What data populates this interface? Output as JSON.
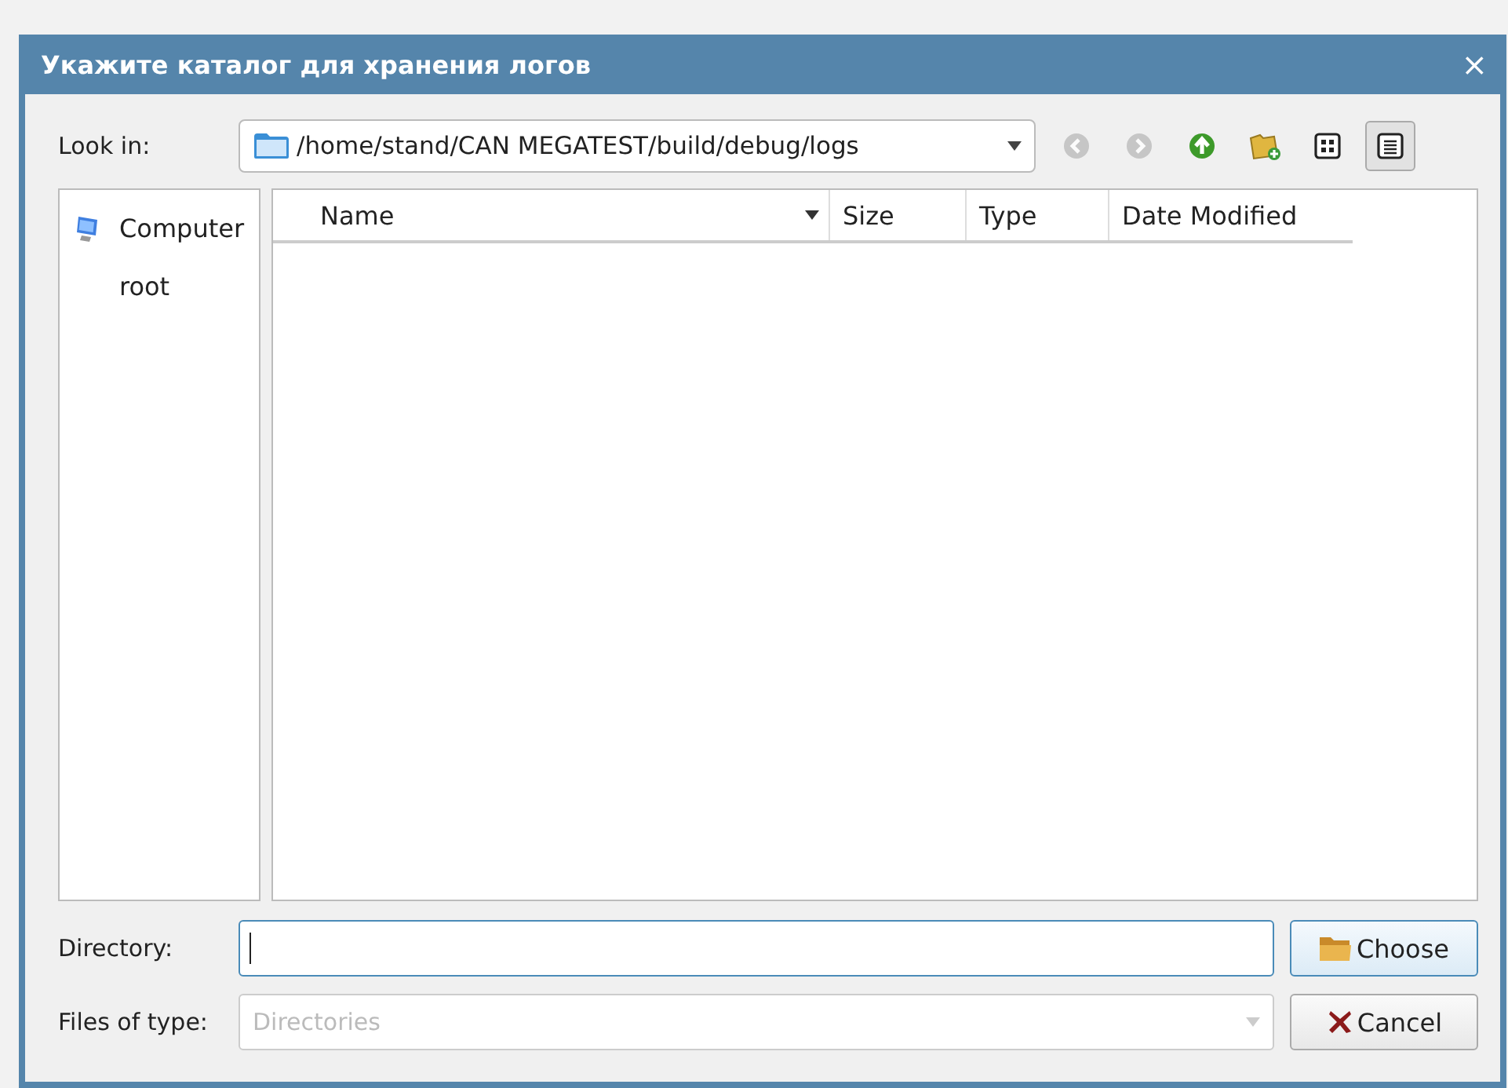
{
  "window": {
    "title": "Укажите каталог для хранения логов",
    "close": "×"
  },
  "look_in": {
    "label": "Look in:",
    "path": "/home/stand/CAN MEGATEST/build/debug/logs"
  },
  "toolbar": [
    {
      "kind": "back",
      "disabled": true,
      "selected": false
    },
    {
      "kind": "forward",
      "disabled": true,
      "selected": false
    },
    {
      "kind": "up",
      "disabled": false,
      "selected": false
    },
    {
      "kind": "new-folder",
      "disabled": false,
      "selected": false
    },
    {
      "kind": "icon-view",
      "disabled": false,
      "selected": false
    },
    {
      "kind": "detail-view",
      "disabled": false,
      "selected": true
    }
  ],
  "sidebar": {
    "items": [
      {
        "label": "Computer",
        "kind": "computer"
      },
      {
        "label": "root",
        "kind": "plain"
      }
    ]
  },
  "table": {
    "columns": [
      {
        "label": "Name",
        "sorted": true
      },
      {
        "label": "Size",
        "sorted": false
      },
      {
        "label": "Type",
        "sorted": false
      },
      {
        "label": "Date Modified",
        "sorted": false
      }
    ]
  },
  "directory": {
    "label": "Directory:"
  },
  "file_type": {
    "label": "Files of type:",
    "value": "Directories",
    "disabled": true
  },
  "buttons": [
    {
      "label": "Choose",
      "kind": "choose"
    },
    {
      "label": "Cancel",
      "kind": "cancel"
    }
  ]
}
